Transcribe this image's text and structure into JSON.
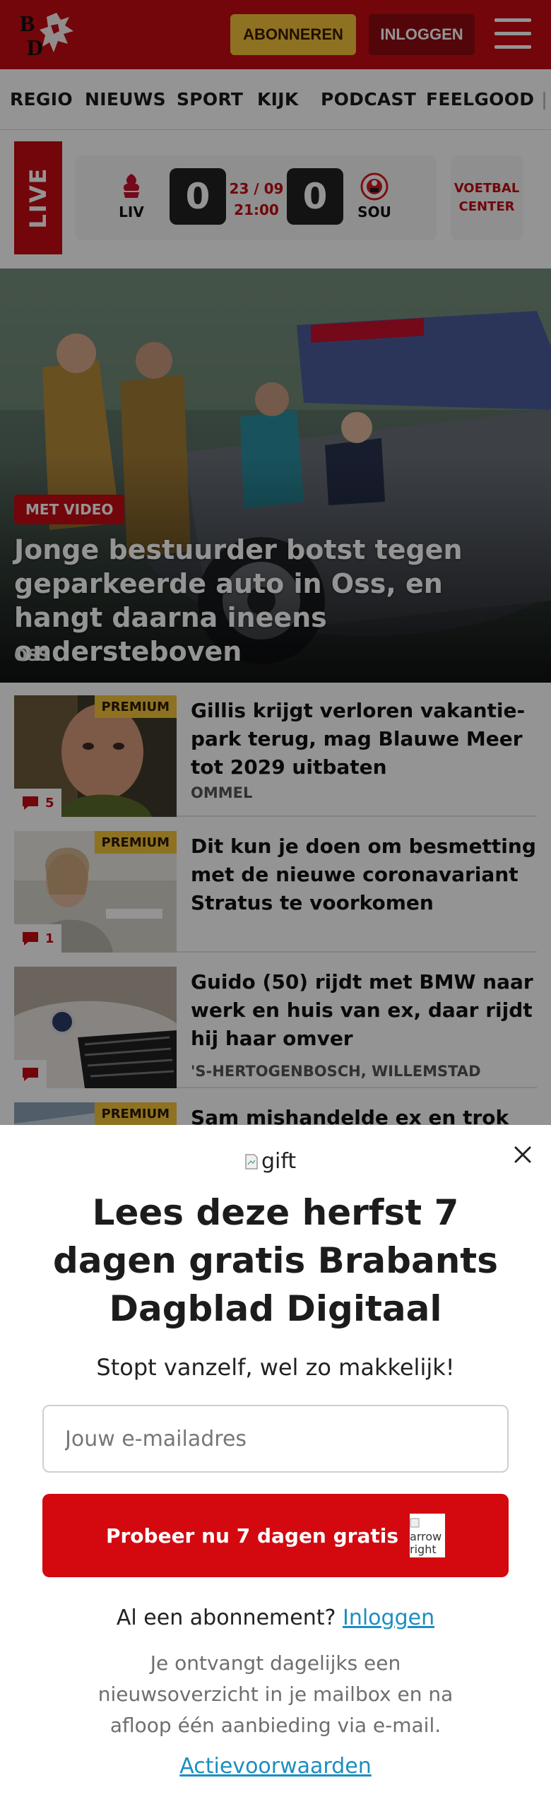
{
  "header": {
    "logo_text": "BD",
    "subscribe_label": "ABONNEREN",
    "login_label": "INLOGGEN"
  },
  "nav": {
    "items": [
      "REGIO",
      "NIEUWS",
      "SPORT",
      "KIJK",
      "PODCAST",
      "FEELGOOD"
    ]
  },
  "live": {
    "label": "LIVE",
    "home_team": "LIV",
    "away_team": "SOU",
    "home_score": "0",
    "away_score": "0",
    "date": "23 / 09",
    "time": "21:00",
    "center_line1": "VOETBAL",
    "center_line2": "CENTER"
  },
  "hero": {
    "badge": "MET VIDEO",
    "title": "Jonge bestuurder botst tegen geparkeerde auto in Oss, en hangt daarna ineens ondersteboven",
    "location": "OSS"
  },
  "articles": [
    {
      "premium": "PREMIUM",
      "comments": "5",
      "title": "Gillis krijgt verloren vakantie-park terug, mag Blauwe Meer tot 2029 uitbaten",
      "location": "OMMEL"
    },
    {
      "premium": "PREMIUM",
      "comments": "1",
      "title": "Dit kun je doen om besmetting met de nieuwe coronavariant Stratus te voorkomen",
      "location": ""
    },
    {
      "premium": "",
      "comments": "",
      "title": "Guido (50) rijdt met BMW naar werk en huis van ex, daar rijdt hij haar omver",
      "location": "'S-HERTOGENBOSCH, WILLEMSTAD"
    },
    {
      "premium": "PREMIUM",
      "comments": "",
      "title": "Sam mishandelde ex en trok mes",
      "location": ""
    }
  ],
  "popup": {
    "gift_alt": "gift",
    "title": "Lees deze herfst 7 dagen gratis Brabants Dagblad Digitaal",
    "subtitle": "Stopt vanzelf, wel zo makkelijk!",
    "email_placeholder": "Jouw e-mailadres",
    "cta_label": "Probeer nu 7 dagen gratis",
    "cta_arrow_alt": "arrow right",
    "have_subscription": "Al een abonnement?",
    "login_link": "Inloggen",
    "info": "Je ontvangt dagelijks een nieuwsoverzicht in je mailbox en na afloop één aanbieding via e-mail.",
    "terms_link": "Actievoorwaarden"
  },
  "colors": {
    "brand_red": "#c40c12",
    "premium_yellow": "#f4c43a",
    "link_blue": "#1b8ec2"
  }
}
